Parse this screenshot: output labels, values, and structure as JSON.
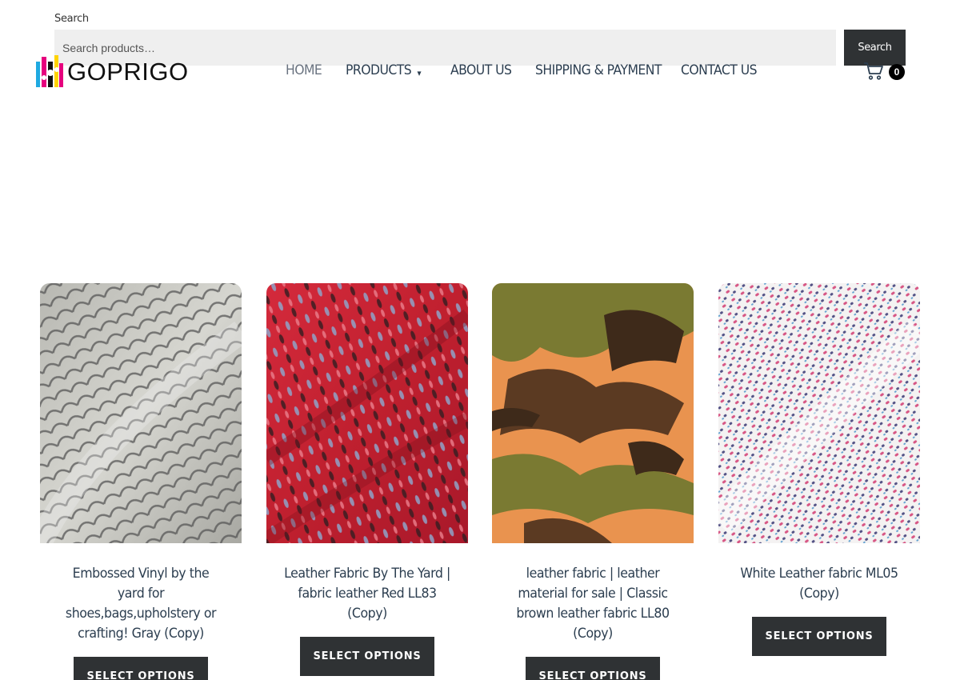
{
  "search": {
    "label": "Search",
    "placeholder": "Search products…",
    "button_label": "Search"
  },
  "logo": {
    "text": "GOPRIGO"
  },
  "nav": {
    "items": [
      {
        "label": "HOME"
      },
      {
        "label": "PRODUCTS"
      },
      {
        "label": "ABOUT US"
      },
      {
        "label": "SHIPPING & PAYMENT"
      },
      {
        "label": "CONTACT US"
      }
    ],
    "caret": "▾"
  },
  "cart": {
    "count": "0"
  },
  "products": [
    {
      "title": "Embossed Vinyl by the yard for shoes,bags,upholstery or crafting! Gray (Copy)",
      "button": "SELECT OPTIONS"
    },
    {
      "title": "Leather Fabric By The Yard | fabric leather Red LL83 (Copy)",
      "button": "SELECT OPTIONS"
    },
    {
      "title": "leather fabric | leather material for sale | Classic brown leather fabric LL80 (Copy)",
      "button": "SELECT OPTIONS"
    },
    {
      "title": "White Leather fabric ML05 (Copy)",
      "button": "SELECT OPTIONS"
    }
  ],
  "colors": {
    "button_bg": "#2f3234",
    "heading": "#2c3e50",
    "search_bg": "#efefef"
  }
}
